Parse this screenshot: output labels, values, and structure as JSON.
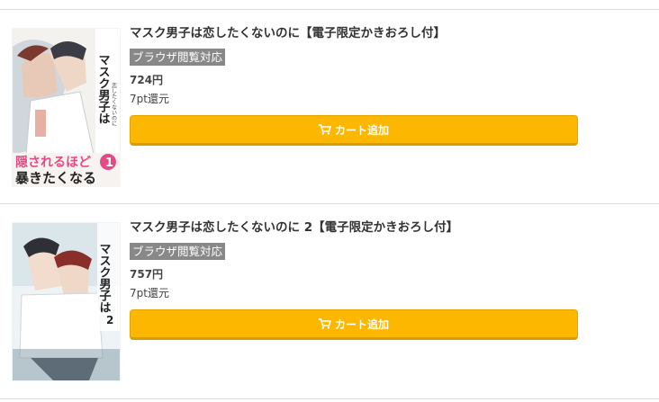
{
  "products": [
    {
      "title": "マスク男子は恋したくないのに【電子限定かきおろし付】",
      "badge": "ブラウザ閲覧対応",
      "price": "724円",
      "points": "7pt還元",
      "cart_label": "カート追加",
      "cover": {
        "series_vertical": "マスク男子は",
        "subtitle_vertical": "恋したくないのに",
        "tagline_pink": "隠されるほど",
        "tagline_black": "暴きたくなる",
        "volume": "1"
      }
    },
    {
      "title": "マスク男子は恋したくないのに 2【電子限定かきおろし付】",
      "badge": "ブラウザ閲覧対応",
      "price": "757円",
      "points": "7pt還元",
      "cart_label": "カート追加",
      "cover": {
        "series_vertical": "マスク男子は",
        "volume": "2"
      }
    }
  ],
  "colors": {
    "cart_button": "#fcb800",
    "badge": "#888888",
    "divider": "#dcdcdc"
  },
  "icons": [
    "cart-icon"
  ]
}
